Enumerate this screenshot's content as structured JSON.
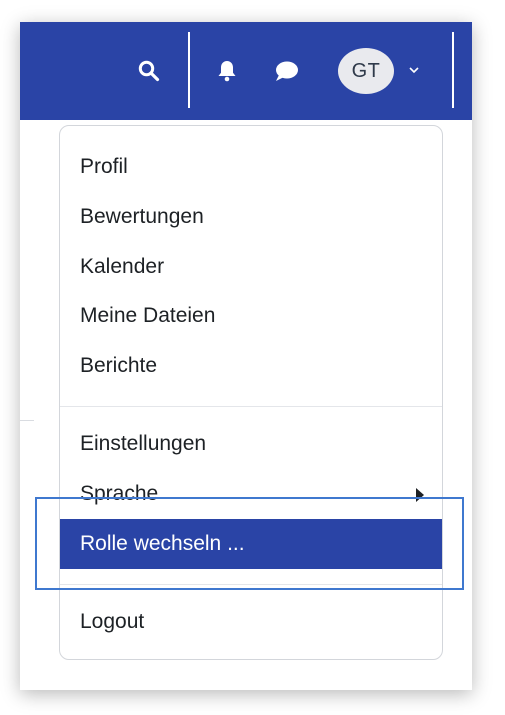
{
  "navbar": {
    "background": "#2a44a6",
    "icons": {
      "search": "search-icon",
      "notifications": "bell-icon",
      "messages": "chat-bubble-icon",
      "menu_chevron": "chevron-down-icon"
    },
    "avatar_initials": "GT"
  },
  "menu": {
    "items": [
      {
        "label": "Profil"
      },
      {
        "label": "Bewertungen"
      },
      {
        "label": "Kalender"
      },
      {
        "label": "Meine Dateien"
      },
      {
        "label": "Berichte"
      },
      {
        "label": "Einstellungen"
      },
      {
        "label": "Sprache"
      },
      {
        "label": "Rolle wechseln ..."
      },
      {
        "label": "Logout"
      }
    ],
    "active_item": "Rolle wechseln ...",
    "active_background": "#2a44a6",
    "submenu_icon": "caret-right-icon"
  },
  "focus_outline_color": "#3f78cf"
}
